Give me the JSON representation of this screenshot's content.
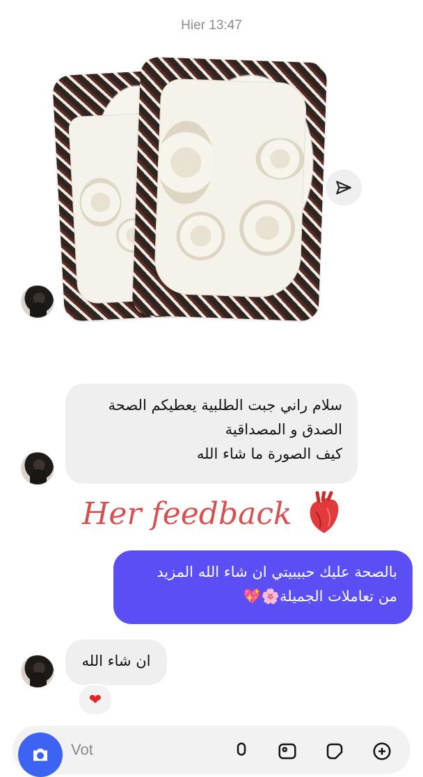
{
  "header": {
    "timestamp": "Hier 13:47"
  },
  "messages": {
    "incoming_1": {
      "lines": [
        "سلام راني جبت الطلبية يعطيكم الصحة",
        "الصدق و المصداقية",
        "كيف الصورة ما شاء الله"
      ]
    },
    "overlay_caption": "Her feedback",
    "outgoing_1": {
      "lines": [
        "بالصحة عليك حبيبيتي ان شاء الله المزيد",
        "من تعاملات الجميلة🌸💖"
      ]
    },
    "incoming_2": {
      "text": "ان شاء الله",
      "reaction": "❤"
    }
  },
  "composer": {
    "placeholder": "Vot"
  },
  "icons": {
    "share": "send-icon",
    "camera": "camera-icon",
    "mic": "mic-icon",
    "gallery": "gallery-icon",
    "sticker": "sticker-icon",
    "add": "plus-icon"
  },
  "colors": {
    "outgoing_bubble": "#5b4ef5",
    "incoming_bubble": "#efefef",
    "camera": "#3c63f3",
    "caption": "#d6504f"
  }
}
